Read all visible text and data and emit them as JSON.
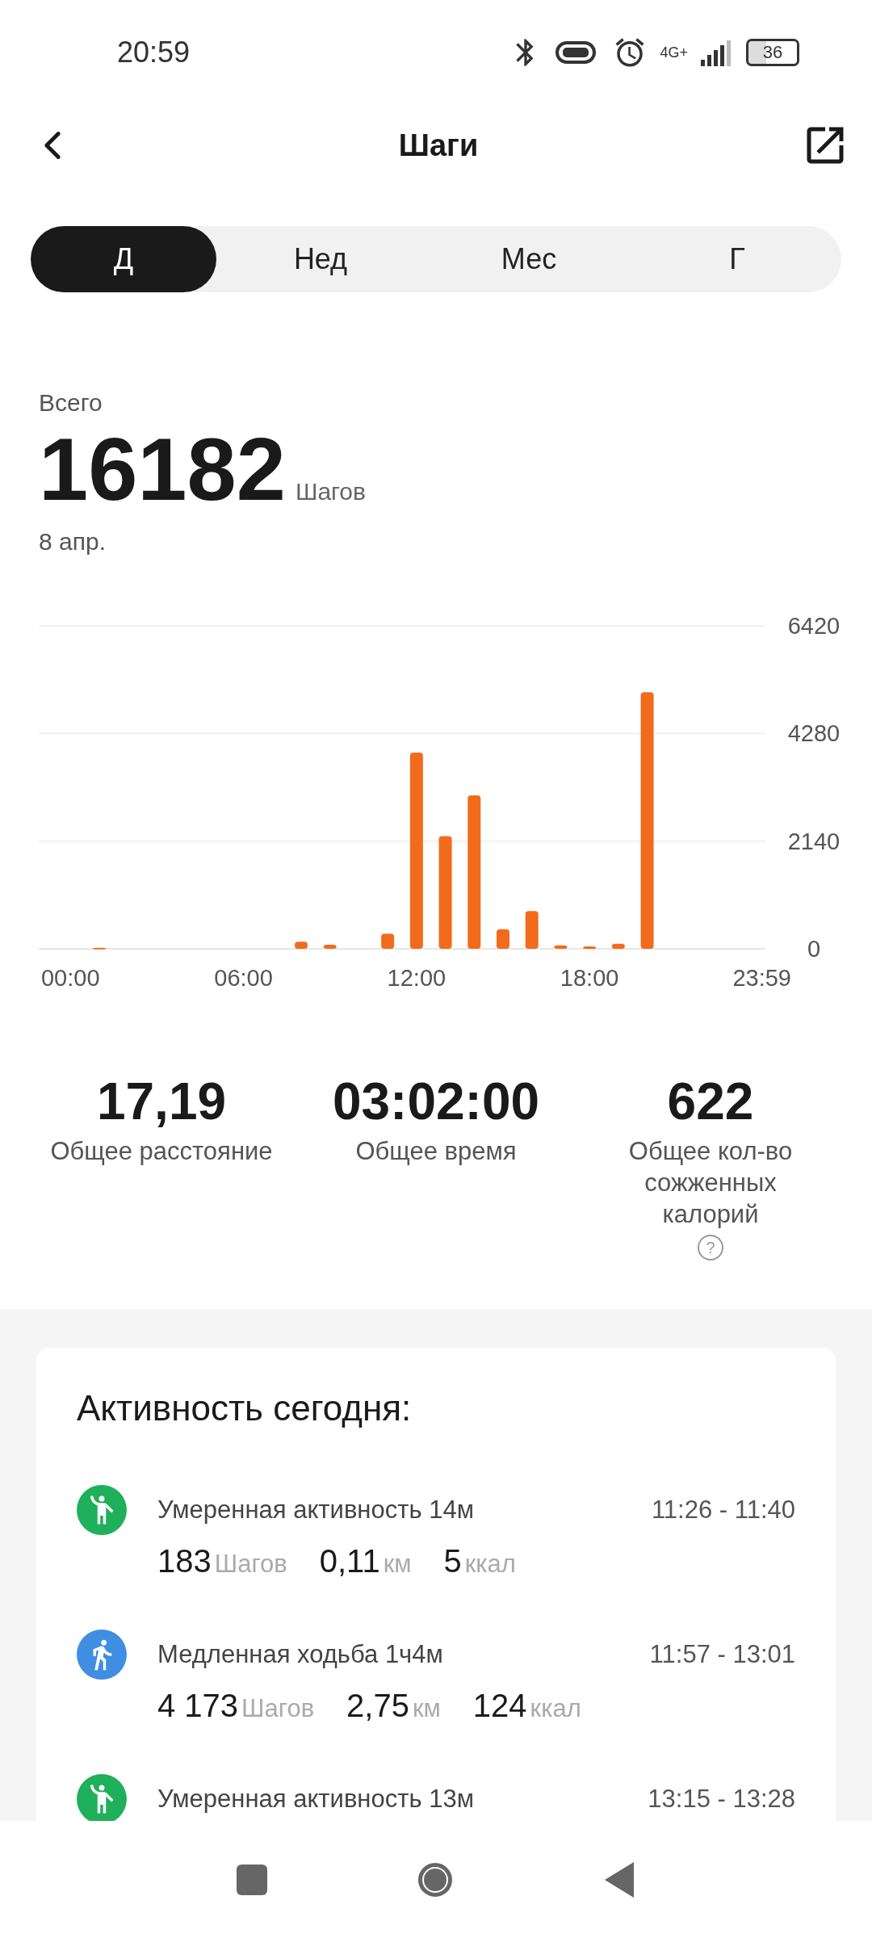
{
  "status_bar": {
    "time": "20:59",
    "network": "4G+",
    "battery": "36"
  },
  "header": {
    "title": "Шаги"
  },
  "tabs": [
    {
      "label": "Д",
      "selected": true
    },
    {
      "label": "Нед",
      "selected": false
    },
    {
      "label": "Мес",
      "selected": false
    },
    {
      "label": "Г",
      "selected": false
    }
  ],
  "summary": {
    "label": "Всего",
    "value": "16182",
    "unit": "Шагов",
    "date": "8 апр."
  },
  "chart_data": {
    "type": "bar",
    "x": [
      1,
      8,
      9,
      11,
      12,
      13,
      14,
      15,
      16,
      17,
      18,
      19,
      20
    ],
    "values": [
      20,
      140,
      80,
      300,
      3900,
      2240,
      3050,
      390,
      750,
      70,
      50,
      100,
      5100
    ],
    "xlim": [
      -1.1,
      24.1
    ],
    "ylim": [
      0,
      6420
    ],
    "yticks": [
      0,
      2140,
      4280,
      6420
    ],
    "xticks": [
      {
        "value": 0,
        "label": "00:00"
      },
      {
        "value": 6,
        "label": "06:00"
      },
      {
        "value": 12,
        "label": "12:00"
      },
      {
        "value": 18,
        "label": "18:00"
      },
      {
        "value": 23.98,
        "label": "23:59"
      }
    ]
  },
  "totals": [
    {
      "value": "17,19",
      "label": "Общее расстояние"
    },
    {
      "value": "03:02:00",
      "label": "Общее время"
    },
    {
      "value": "622",
      "label": "Общее кол-во сожженных калорий",
      "help_icon": "?"
    }
  ],
  "activity": {
    "title": "Активность сегодня:",
    "items": [
      {
        "kind": "moderate",
        "color": "#1eb05a",
        "name": "Умеренная активность 14м",
        "time": "11:26 - 11:40",
        "stats": [
          {
            "value": "183",
            "unit": "Шагов"
          },
          {
            "value": "0,11",
            "unit": "км"
          },
          {
            "value": "5",
            "unit": "ккал"
          }
        ]
      },
      {
        "kind": "walk",
        "color": "#3f8ee2",
        "name": "Медленная ходьба 1ч4м",
        "time": "11:57 - 13:01",
        "stats": [
          {
            "value": "4 173",
            "unit": "Шагов"
          },
          {
            "value": "2,75",
            "unit": "км"
          },
          {
            "value": "124",
            "unit": "ккал"
          }
        ]
      },
      {
        "kind": "moderate",
        "color": "#1eb05a",
        "name": "Умеренная активность 13м",
        "time": "13:15 - 13:28"
      }
    ]
  }
}
